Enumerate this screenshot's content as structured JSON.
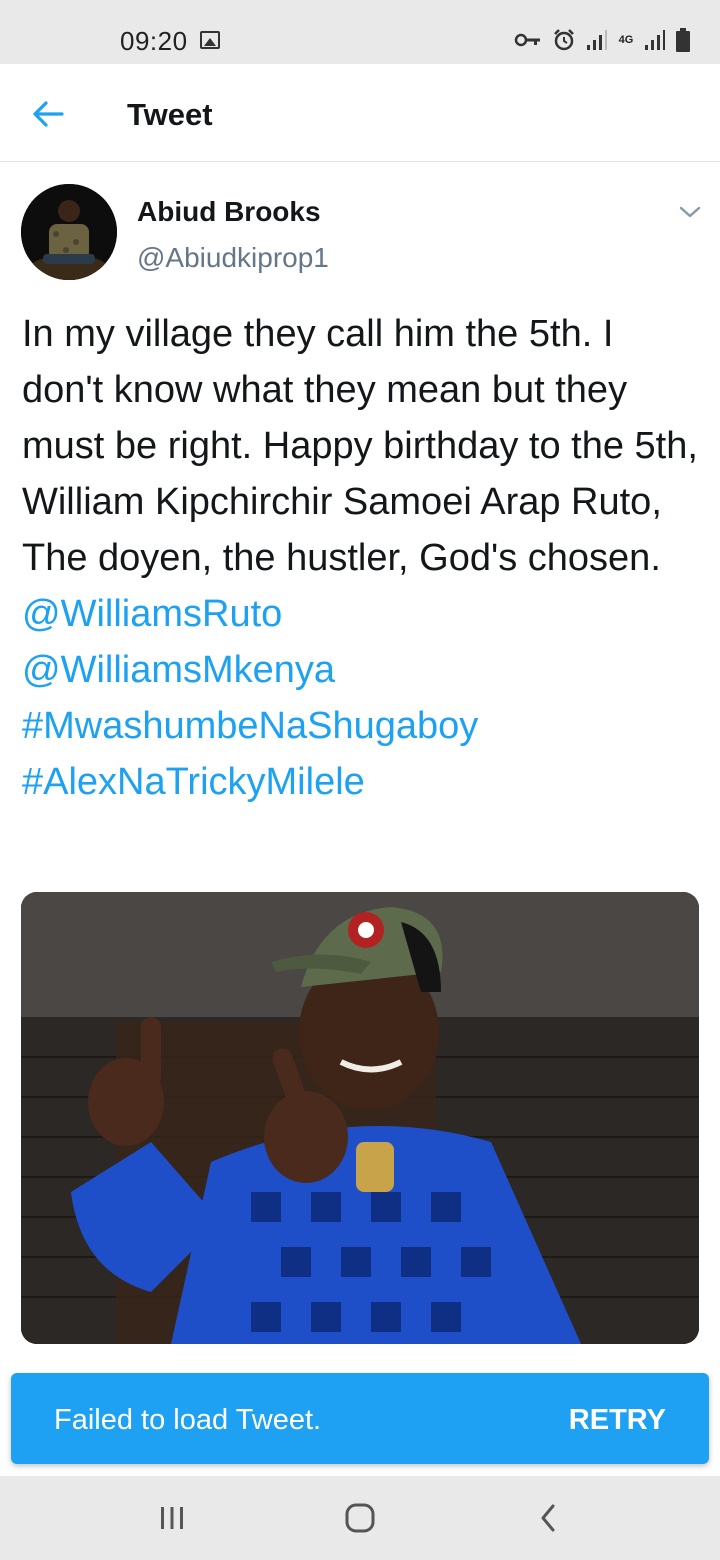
{
  "status_bar": {
    "time": "09:20",
    "network_label": "4G",
    "icons": [
      "gallery-icon",
      "key-icon",
      "alarm-icon",
      "signal-icon",
      "network-4g-icon",
      "signal-icon",
      "battery-icon"
    ]
  },
  "app_bar": {
    "title": "Tweet",
    "back_icon": "arrow-left-icon"
  },
  "tweet": {
    "author_name": "Abiud Brooks",
    "author_handle": "@Abiudkiprop1",
    "text_plain": "In my village they call him the 5th. I don't know what they mean but they must be right. Happy birthday to  the 5th, William Kipchirchir Samoei Arap Ruto,  The doyen,  the hustler, God's chosen. ",
    "mention_1": "@WilliamsRuto",
    "mention_2": "@WilliamsMkenya",
    "hashtag_1": "#MwashumbeNaShugaboy",
    "hashtag_2": "#AlexNaTrickyMilele",
    "menu_icon": "chevron-down-icon"
  },
  "snackbar": {
    "message": "Failed to load Tweet.",
    "action": "RETRY"
  },
  "nav_bar": {
    "buttons": [
      "recents-icon",
      "home-icon",
      "back-icon"
    ]
  },
  "colors": {
    "link": "#1da1f2",
    "snackbar": "#1ea1f2",
    "handle": "#657786",
    "status_bar_bg": "#e9e9e9"
  }
}
